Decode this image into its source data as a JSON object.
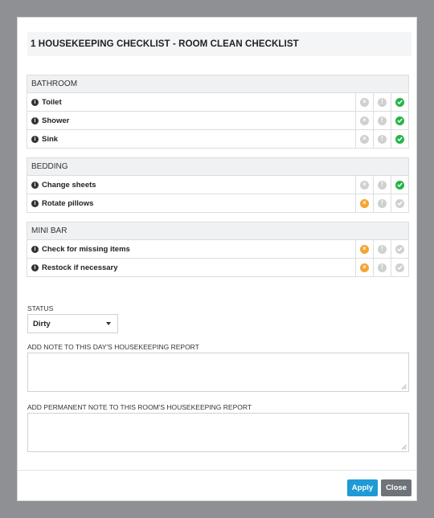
{
  "modal": {
    "title": "1 HOUSEKEEPING CHECKLIST - ROOM CLEAN CHECKLIST"
  },
  "sections": [
    {
      "title": "BATHROOM",
      "items": [
        {
          "label": "Toilet",
          "status": [
            "grey-x",
            "grey-info",
            "green-check"
          ]
        },
        {
          "label": "Shower",
          "status": [
            "grey-x",
            "grey-info",
            "green-check"
          ]
        },
        {
          "label": "Sink",
          "status": [
            "grey-x",
            "grey-info",
            "green-check"
          ]
        }
      ]
    },
    {
      "title": "BEDDING",
      "items": [
        {
          "label": "Change sheets",
          "status": [
            "grey-x",
            "grey-info",
            "green-check"
          ]
        },
        {
          "label": "Rotate pillows",
          "status": [
            "orange-x",
            "grey-info",
            "grey-check"
          ]
        }
      ]
    },
    {
      "title": "MINI BAR",
      "items": [
        {
          "label": "Check for missing items",
          "status": [
            "orange-x",
            "grey-info",
            "grey-check"
          ]
        },
        {
          "label": "Restock if necessary",
          "status": [
            "orange-x",
            "grey-info",
            "grey-check"
          ]
        }
      ]
    }
  ],
  "form": {
    "status_label": "STATUS",
    "status_value": "Dirty",
    "day_note_label": "ADD NOTE TO THIS DAY'S HOUSEKEEPING REPORT",
    "day_note_value": "",
    "permanent_note_label": "ADD PERMANENT NOTE TO THIS ROOM'S HOUSEKEEPING REPORT",
    "permanent_note_value": ""
  },
  "buttons": {
    "apply_label": "Apply",
    "close_label": "Close"
  },
  "colors": {
    "accent": "#1f9ad6",
    "green": "#26b44a",
    "orange": "#f4a531",
    "grey": "#cfd0d2",
    "close_button": "#6e7479"
  }
}
